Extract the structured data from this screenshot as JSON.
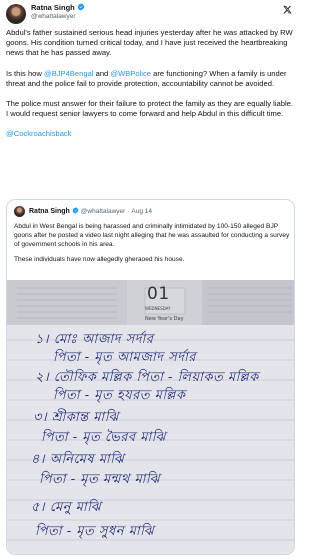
{
  "tweet": {
    "author": {
      "name": "Ratna Singh",
      "handle": "@whattalawyer"
    },
    "paragraphs": {
      "p1": "Abdul's father sustained serious head injuries yesterday after he was attacked by RW goons. His condition turned critical today, and I have just received the heartbreaking news that he has passed away.",
      "p2_before": "Is this how ",
      "p2_mention1": "@BJP4Bengal",
      "p2_mid": " and ",
      "p2_mention2": "@WBPolice",
      "p2_after": " are functioning? When a family is under threat and the police fail to provide protection, accountability cannot be avoided.",
      "p3": "The police must answer for their failure to protect the family as they are equally liable. I would request senior lawyers to come forward and help Abdul in this difficult time.",
      "p4_mention": "@Cockroachisback"
    },
    "icons": {
      "verified": "verified-badge-icon",
      "platform": "x-logo-icon"
    },
    "colors": {
      "link": "#1d9bf0",
      "verified": "#1d9bf0",
      "text": "#0f1419",
      "muted": "#536471"
    }
  },
  "quote": {
    "author": {
      "name": "Ratna Singh",
      "handle": "@whattalawyer",
      "separator": "·",
      "date": "Aug 14"
    },
    "text": {
      "p1": "Abdul in West Bengal is being harassed and criminally intimidated by 100-150 alleged BJP goons after he posted a video last night alleging that he was assaulted for conducting a survey of government schools in his area.",
      "p2": "These individuals have now allegedly gheraoed his house."
    },
    "photo": {
      "desc_visible_date": "01",
      "day": "WEDNESDAY",
      "new_years_day": "New Year's Day",
      "handwritten_lines": [
        "১। মোঃ আজাদ সর্দার",
        "পিতা - মৃত আমজাদ সর্দার",
        "২। তৌফিক মল্লিক পিতা - লিয়াকত মল্লিক",
        "পিতা - মৃত হযরত মল্লিক",
        "৩। শ্রীকান্ত মাঝি",
        "পিতা - মৃত ভৈরব মাঝি",
        "৪। অনিমেষ মাঝি",
        "পিতা - মৃত মন্মথ মাঝি",
        "৫। মেনু মাঝি",
        "পিতা - মৃত সুধন মাঝি"
      ]
    }
  }
}
